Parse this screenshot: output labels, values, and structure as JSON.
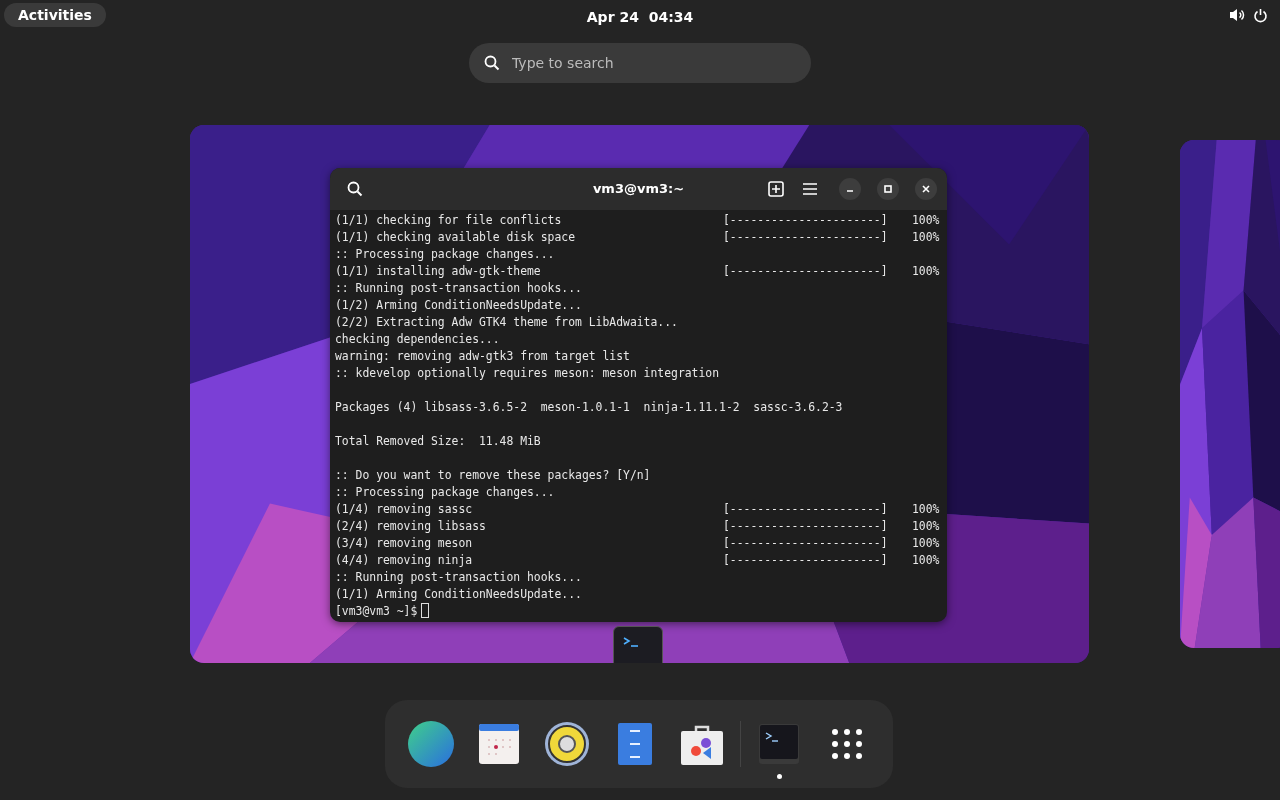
{
  "top_bar": {
    "activities": "Activities",
    "clock": "Apr 24  04:34"
  },
  "search": {
    "placeholder": "Type to search"
  },
  "window": {
    "title": "vm3@vm3:~",
    "lines": [
      {
        "kind": "line",
        "text": "(1/1) checking for file conflicts",
        "bar": "[----------------------]",
        "percent": "100%"
      },
      {
        "kind": "line",
        "text": "(1/1) checking available disk space",
        "bar": "[----------------------]",
        "percent": "100%"
      },
      {
        "kind": "line",
        "text": ":: Processing package changes..."
      },
      {
        "kind": "line",
        "text": "(1/1) installing adw-gtk-theme",
        "bar": "[----------------------]",
        "percent": "100%"
      },
      {
        "kind": "line",
        "text": ":: Running post-transaction hooks..."
      },
      {
        "kind": "line",
        "text": "(1/2) Arming ConditionNeedsUpdate..."
      },
      {
        "kind": "line",
        "text": "(2/2) Extracting Adw GTK4 theme from LibAdwaita..."
      },
      {
        "kind": "line",
        "text": "checking dependencies..."
      },
      {
        "kind": "line",
        "text": "warning: removing adw-gtk3 from target list"
      },
      {
        "kind": "line",
        "text": ":: kdevelop optionally requires meson: meson integration"
      },
      {
        "kind": "blank"
      },
      {
        "kind": "line",
        "text": "Packages (4) libsass-3.6.5-2  meson-1.0.1-1  ninja-1.11.1-2  sassc-3.6.2-3"
      },
      {
        "kind": "blank"
      },
      {
        "kind": "line",
        "text": "Total Removed Size:  11.48 MiB"
      },
      {
        "kind": "blank"
      },
      {
        "kind": "line",
        "text": ":: Do you want to remove these packages? [Y/n]"
      },
      {
        "kind": "line",
        "text": ":: Processing package changes..."
      },
      {
        "kind": "line",
        "text": "(1/4) removing sassc",
        "bar": "[----------------------]",
        "percent": "100%"
      },
      {
        "kind": "line",
        "text": "(2/4) removing libsass",
        "bar": "[----------------------]",
        "percent": "100%"
      },
      {
        "kind": "line",
        "text": "(3/4) removing meson",
        "bar": "[----------------------]",
        "percent": "100%"
      },
      {
        "kind": "line",
        "text": "(4/4) removing ninja",
        "bar": "[----------------------]",
        "percent": "100%"
      },
      {
        "kind": "line",
        "text": ":: Running post-transaction hooks..."
      },
      {
        "kind": "line",
        "text": "(1/1) Arming ConditionNeedsUpdate..."
      },
      {
        "kind": "prompt",
        "text": "[vm3@vm3 ~]$"
      }
    ]
  },
  "dock": [
    {
      "kind": "browser",
      "running": false
    },
    {
      "kind": "calendar",
      "running": false
    },
    {
      "kind": "speaker",
      "running": false
    },
    {
      "kind": "files",
      "running": false
    },
    {
      "kind": "store",
      "running": false
    },
    {
      "kind": "separator"
    },
    {
      "kind": "terminal",
      "running": true
    },
    {
      "kind": "apps",
      "running": false
    }
  ]
}
